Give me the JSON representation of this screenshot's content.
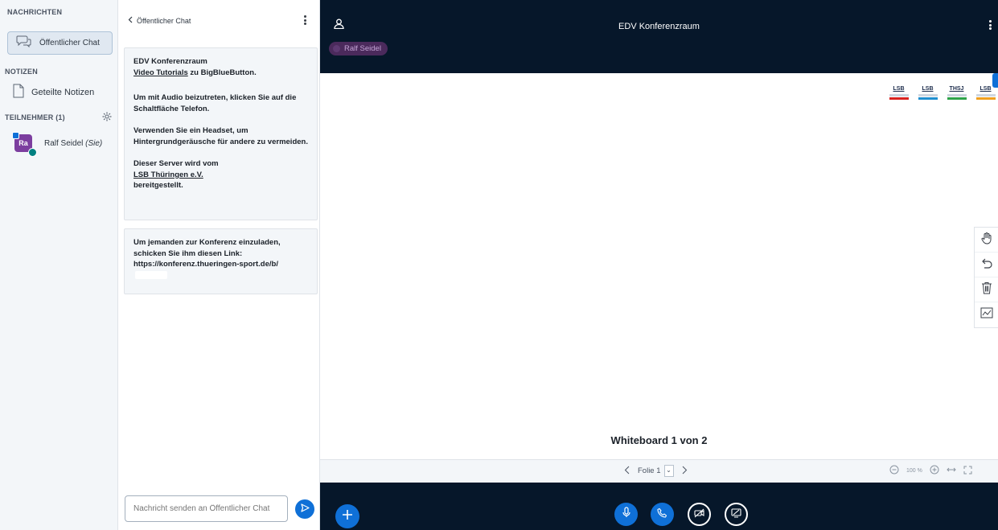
{
  "sidebar": {
    "messages_title": "NACHRICHTEN",
    "public_chat_label": "Öffentlicher Chat",
    "notes_title": "NOTIZEN",
    "shared_notes_label": "Geteilte Notizen",
    "participants_title": "TEILNEHMER (1)",
    "user": {
      "initials": "Ra",
      "name": "Ralf Seidel",
      "you_tag": "(Sie)",
      "avatar_color": "#7c3e9f"
    }
  },
  "chat": {
    "back_label": "Öffentlicher Chat",
    "welcome": {
      "title": "EDV Konferenzraum",
      "tutorials_link": "Video Tutorials",
      "tutorials_rest": " zu BigBlueButton.",
      "audio_hint": "Um mit Audio beizutreten, klicken Sie auf die Schaltfläche Telefon.",
      "headset_hint": "Verwenden Sie ein Headset, um Hintergrundgeräusche für andere zu vermeiden.",
      "server_line1": "Dieser Server wird vom",
      "server_link": "LSB Thüringen e.V.",
      "server_line2": "bereitgestellt."
    },
    "invite": {
      "text": "Um jemanden zur Konferenz einzuladen, schicken Sie ihm diesen Link:",
      "link": "https://konferenz.thueringen-sport.de/b/"
    },
    "input_placeholder": "Nachricht senden an Öffentlicher Chat"
  },
  "navbar": {
    "meeting_title": "EDV Konferenzraum",
    "talker": "Ralf Seidel"
  },
  "whiteboard": {
    "logos": [
      {
        "text": "LSB",
        "accent": "#d9231f",
        "stripe": "#d9231f"
      },
      {
        "text": "LSB",
        "accent": "#d9231f",
        "stripe": "#1f8fd0"
      },
      {
        "text": "THSJ",
        "accent": "#d9231f",
        "stripe": "#2ea34a"
      },
      {
        "text": "LSB",
        "accent": "#d9231f",
        "stripe": "#f0a020"
      }
    ],
    "title": "Whiteboard 1 von 2"
  },
  "pres_toolbar": {
    "slide_label": "Folie 1",
    "zoom": "100 %"
  },
  "colors": {
    "primary": "#0f70d7",
    "dark_bg": "#06172a",
    "panel_bg": "#f3f6f9"
  }
}
